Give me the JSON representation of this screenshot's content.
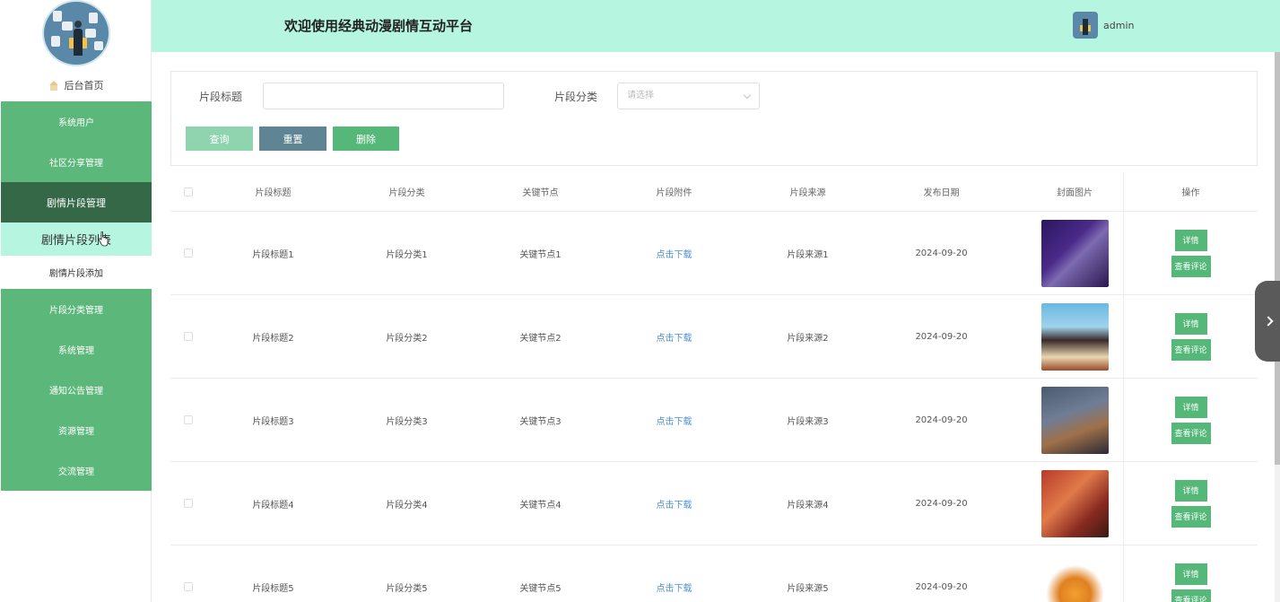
{
  "header": {
    "title": "欢迎使用经典动漫剧情互动平台",
    "username": "admin"
  },
  "sidebar": {
    "home": "后台首页",
    "items": [
      {
        "label": "系统用户"
      },
      {
        "label": "社区分享管理"
      },
      {
        "label": "剧情片段管理"
      },
      {
        "label": "剧情片段列表"
      },
      {
        "label": "剧情片段添加"
      },
      {
        "label": "片段分类管理"
      },
      {
        "label": "系统管理"
      },
      {
        "label": "通知公告管理"
      },
      {
        "label": "资源管理"
      },
      {
        "label": "交流管理"
      }
    ]
  },
  "search": {
    "title_label": "片段标题",
    "title_value": "",
    "category_label": "片段分类",
    "category_placeholder": "请选择",
    "query_button": "查询",
    "reset_button": "重置",
    "delete_button": "删除"
  },
  "table": {
    "columns": [
      "片段标题",
      "片段分类",
      "关键节点",
      "片段附件",
      "片段来源",
      "发布日期",
      "封面图片",
      "操作"
    ],
    "rows": [
      {
        "title": "片段标题1",
        "category": "片段分类1",
        "node": "关键节点1",
        "attachment": "点击下载",
        "source": "片段来源1",
        "date": "2024-09-20"
      },
      {
        "title": "片段标题2",
        "category": "片段分类2",
        "node": "关键节点2",
        "attachment": "点击下载",
        "source": "片段来源2",
        "date": "2024-09-20"
      },
      {
        "title": "片段标题3",
        "category": "片段分类3",
        "node": "关键节点3",
        "attachment": "点击下载",
        "source": "片段来源3",
        "date": "2024-09-20"
      },
      {
        "title": "片段标题4",
        "category": "片段分类4",
        "node": "关键节点4",
        "attachment": "点击下载",
        "source": "片段来源4",
        "date": "2024-09-20"
      },
      {
        "title": "片段标题5",
        "category": "片段分类5",
        "node": "关键节点5",
        "attachment": "点击下载",
        "source": "片段来源5",
        "date": "2024-09-20"
      }
    ],
    "detail_button": "详情",
    "review_button": "查看评论"
  },
  "colors": {
    "header_bg": "#b6f5df",
    "menu_bg": "#5cb87a",
    "menu_active_bg": "#346847",
    "button_green": "#55b778",
    "button_reset": "#5f8494",
    "link": "#4a90d9"
  }
}
